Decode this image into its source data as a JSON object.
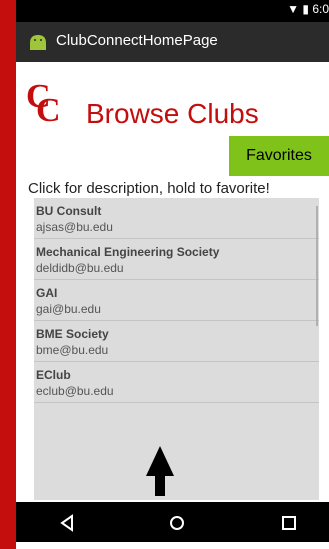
{
  "status_bar": {
    "time": "6:0"
  },
  "app_bar": {
    "title": "ClubConnectHomePage"
  },
  "logo": {
    "letter_1": "C",
    "letter_2": "C"
  },
  "page": {
    "title": "Browse Clubs",
    "favorites_label": "Favorites",
    "instructions": "Click for description, hold to favorite!"
  },
  "clubs": [
    {
      "name": "BU Consult",
      "email": "ajsas@bu.edu"
    },
    {
      "name": "Mechanical Engineering Society",
      "email": "deldidb@bu.edu"
    },
    {
      "name": "GAI",
      "email": "gai@bu.edu"
    },
    {
      "name": "BME Society",
      "email": "bme@bu.edu"
    },
    {
      "name": "EClub",
      "email": "eclub@bu.edu"
    }
  ],
  "colors": {
    "brand_red": "#c40d0d",
    "favorites_green": "#7fc21a"
  }
}
